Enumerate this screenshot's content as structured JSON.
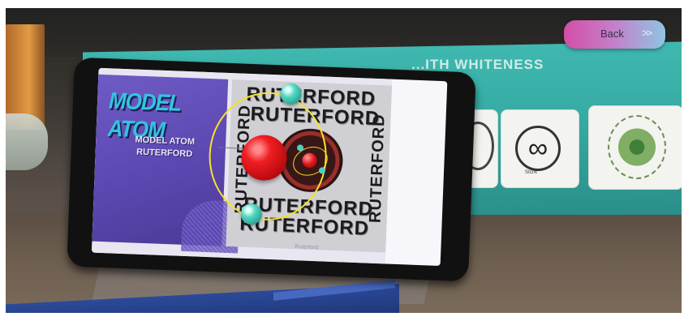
{
  "nav": {
    "back_label": "Back",
    "back_icon": "double-chevron-right"
  },
  "background_box": {
    "title": "...ITH WHITENESS",
    "badge_caption": "SIGN"
  },
  "slide": {
    "title": "MODEL ATOM",
    "subtitle_line1": "MODEL ATOM",
    "subtitle_line2": "RUTERFORD",
    "word_art": "RUTERFORD",
    "watermark": "Ruterford"
  },
  "colors": {
    "back_gradient_start": "#d24fa6",
    "back_gradient_end": "#8fc5e2",
    "nucleus": "#f01e22",
    "electron": "#53d8c2",
    "orbit": "#f5e22a",
    "slide_panel": "#5a46ae",
    "title": "#35c3e0"
  }
}
